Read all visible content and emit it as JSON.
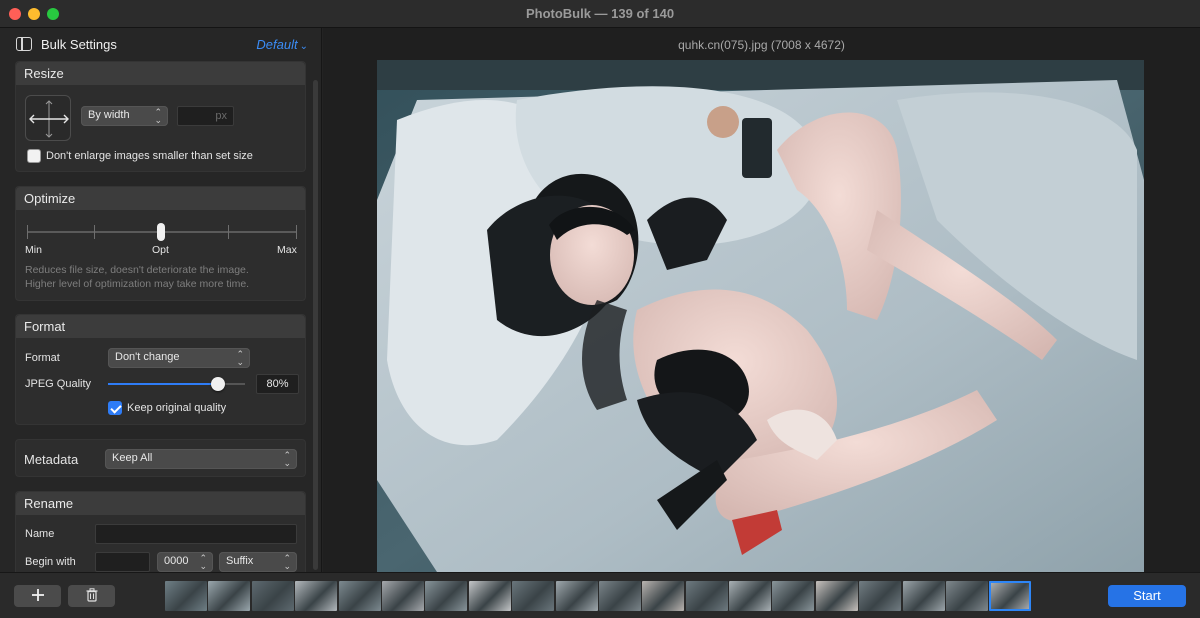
{
  "window": {
    "title": "PhotoBulk — 139 of 140"
  },
  "sidebar": {
    "title": "Bulk Settings",
    "preset": "Default",
    "resize": {
      "header": "Resize",
      "mode": "By width",
      "unit": "px",
      "no_enlarge_label": "Don't enlarge images smaller than set size",
      "no_enlarge_checked": false
    },
    "optimize": {
      "header": "Optimize",
      "min_label": "Min",
      "opt_label": "Opt",
      "max_label": "Max",
      "level": "Opt",
      "hint_line1": "Reduces file size, doesn't deteriorate the image.",
      "hint_line2": "Higher level of optimization may take more time."
    },
    "format": {
      "header": "Format",
      "format_label": "Format",
      "format_value": "Don't change",
      "quality_label": "JPEG Quality",
      "quality_value": "80%",
      "quality_fraction": 0.8,
      "keep_quality_label": "Keep original quality",
      "keep_quality_checked": true
    },
    "metadata": {
      "label": "Metadata",
      "value": "Keep All"
    },
    "rename": {
      "header": "Rename",
      "name_label": "Name",
      "begin_label": "Begin with",
      "counter_value": "0000",
      "position_value": "Suffix"
    }
  },
  "main": {
    "file_title": "quhk.cn(075).jpg (7008 x 4672)"
  },
  "bottombar": {
    "add_icon": "plus-icon",
    "delete_icon": "trash-icon",
    "start_label": "Start"
  },
  "colors": {
    "accent": "#2e7cf6",
    "start_button": "#2673e6",
    "preset_link": "#3b8cf5"
  }
}
